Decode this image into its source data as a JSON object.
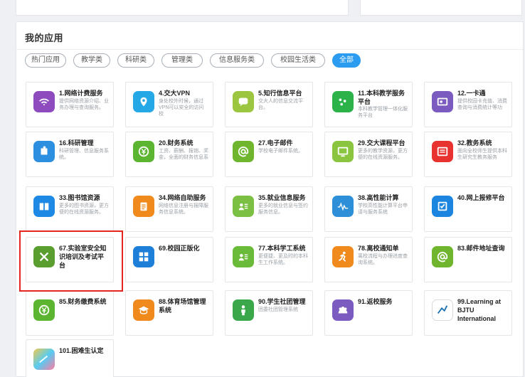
{
  "section_title": "我的应用",
  "filters": [
    "热门应用",
    "教学类",
    "科研类",
    "管理类",
    "信息服务类",
    "校园生活类",
    "全部"
  ],
  "active_filter": "全部",
  "apps": [
    {
      "title": "1.网络计费服务",
      "desc": "提供网络资源介绍、业务办理与查询服务。",
      "icon": "wifi-icon",
      "color": "#8d4bbd"
    },
    {
      "title": "4.交大VPN",
      "desc": "身处校外时候，通过VPN可以安全的访问校",
      "icon": "location-pin-icon",
      "color": "#24a8e6"
    },
    {
      "title": "5.知行信息平台",
      "desc": "交大人的信息交流平台。",
      "icon": "chat-bubble-icon",
      "color": "#9cc640"
    },
    {
      "title": "11.本科教学服务平台",
      "desc": "本科教学管理一体化服务平台",
      "icon": "dots-icon",
      "color": "#2bb34a"
    },
    {
      "title": "12.一卡通",
      "desc": "提供校园卡充值、消费查询与消费统计等功",
      "icon": "id-card-icon",
      "color": "#7b5bbf"
    },
    {
      "title": "16.科研管理",
      "desc": "科研管理、信息服务系统。",
      "icon": "puzzle-icon",
      "color": "#2c8fe0"
    },
    {
      "title": "20.财务系统",
      "desc": "工资、薪酬、报销、奖金，全面的财务信息系",
      "icon": "yen-icon",
      "color": "#5cb531"
    },
    {
      "title": "27.电子邮件",
      "desc": "学校电子邮件系统。",
      "icon": "at-icon",
      "color": "#6fb52e"
    },
    {
      "title": "29.交大课程平台",
      "desc": "更多的教学资源，更方便的在线资源服务。",
      "icon": "monitor-icon",
      "color": "#8bc53f"
    },
    {
      "title": "32.教务系统",
      "desc": "面向全校师生提供本科生研究生教务服务",
      "icon": "calendar-icon",
      "color": "#e8322f"
    },
    {
      "title": "33.图书馆资源",
      "desc": "更多的图书资源，更方便的在线资源服务。",
      "icon": "book-icon",
      "color": "#1e88e5"
    },
    {
      "title": "34.网络自助服务",
      "desc": "网络信息注册与报障服务信息系统。",
      "icon": "clipboard-icon",
      "color": "#f08a1c"
    },
    {
      "title": "35.就业信息服务",
      "desc": "更多的就业信息与签约服务信息。",
      "icon": "user-list-icon",
      "color": "#7bc043"
    },
    {
      "title": "38.高性能计算",
      "desc": "学校高性能计算平台申请与服务系统",
      "icon": "waveform-icon",
      "color": "#2c8fd8"
    },
    {
      "title": "40.网上报修平台",
      "desc": "",
      "icon": "checkbox-icon",
      "color": "#1b85e0"
    },
    {
      "title": "67.实验室安全知识培训及考试平台",
      "desc": "",
      "icon": "tools-icon",
      "color": "#5a9e2f"
    },
    {
      "title": "69.校园正版化",
      "desc": "",
      "icon": "windows-icon",
      "color": "#1e7fd9"
    },
    {
      "title": "77.本科学工系统",
      "desc": "更便捷、更及时的本科生工作系统。",
      "icon": "user-list-icon",
      "color": "#6bbb3a"
    },
    {
      "title": "78.离校通知单",
      "desc": "离校流程与办理进度查询系统。",
      "icon": "runner-icon",
      "color": "#f08a1c"
    },
    {
      "title": "83.邮件地址查询",
      "desc": "",
      "icon": "at-icon",
      "color": "#6fb52e"
    },
    {
      "title": "85.财务缴费系统",
      "desc": "",
      "icon": "yen-icon",
      "color": "#5cb531"
    },
    {
      "title": "88.体育场馆管理系统",
      "desc": "",
      "icon": "graduation-cap-icon",
      "color": "#f08a1c"
    },
    {
      "title": "90.学生社团管理",
      "desc": "团委社团管理系统",
      "icon": "person-icon",
      "color": "#3aa84a"
    },
    {
      "title": "91.返校服务",
      "desc": "",
      "icon": "group-icon",
      "color": "#7b5bbf"
    },
    {
      "title": "99.Learning at BJTU International",
      "desc": "",
      "icon": "pen-check-icon",
      "color": "#ffffff"
    },
    {
      "title": "101.困难生认定",
      "desc": "",
      "icon": "gradient-icon",
      "color": "#5aa8e6"
    }
  ]
}
